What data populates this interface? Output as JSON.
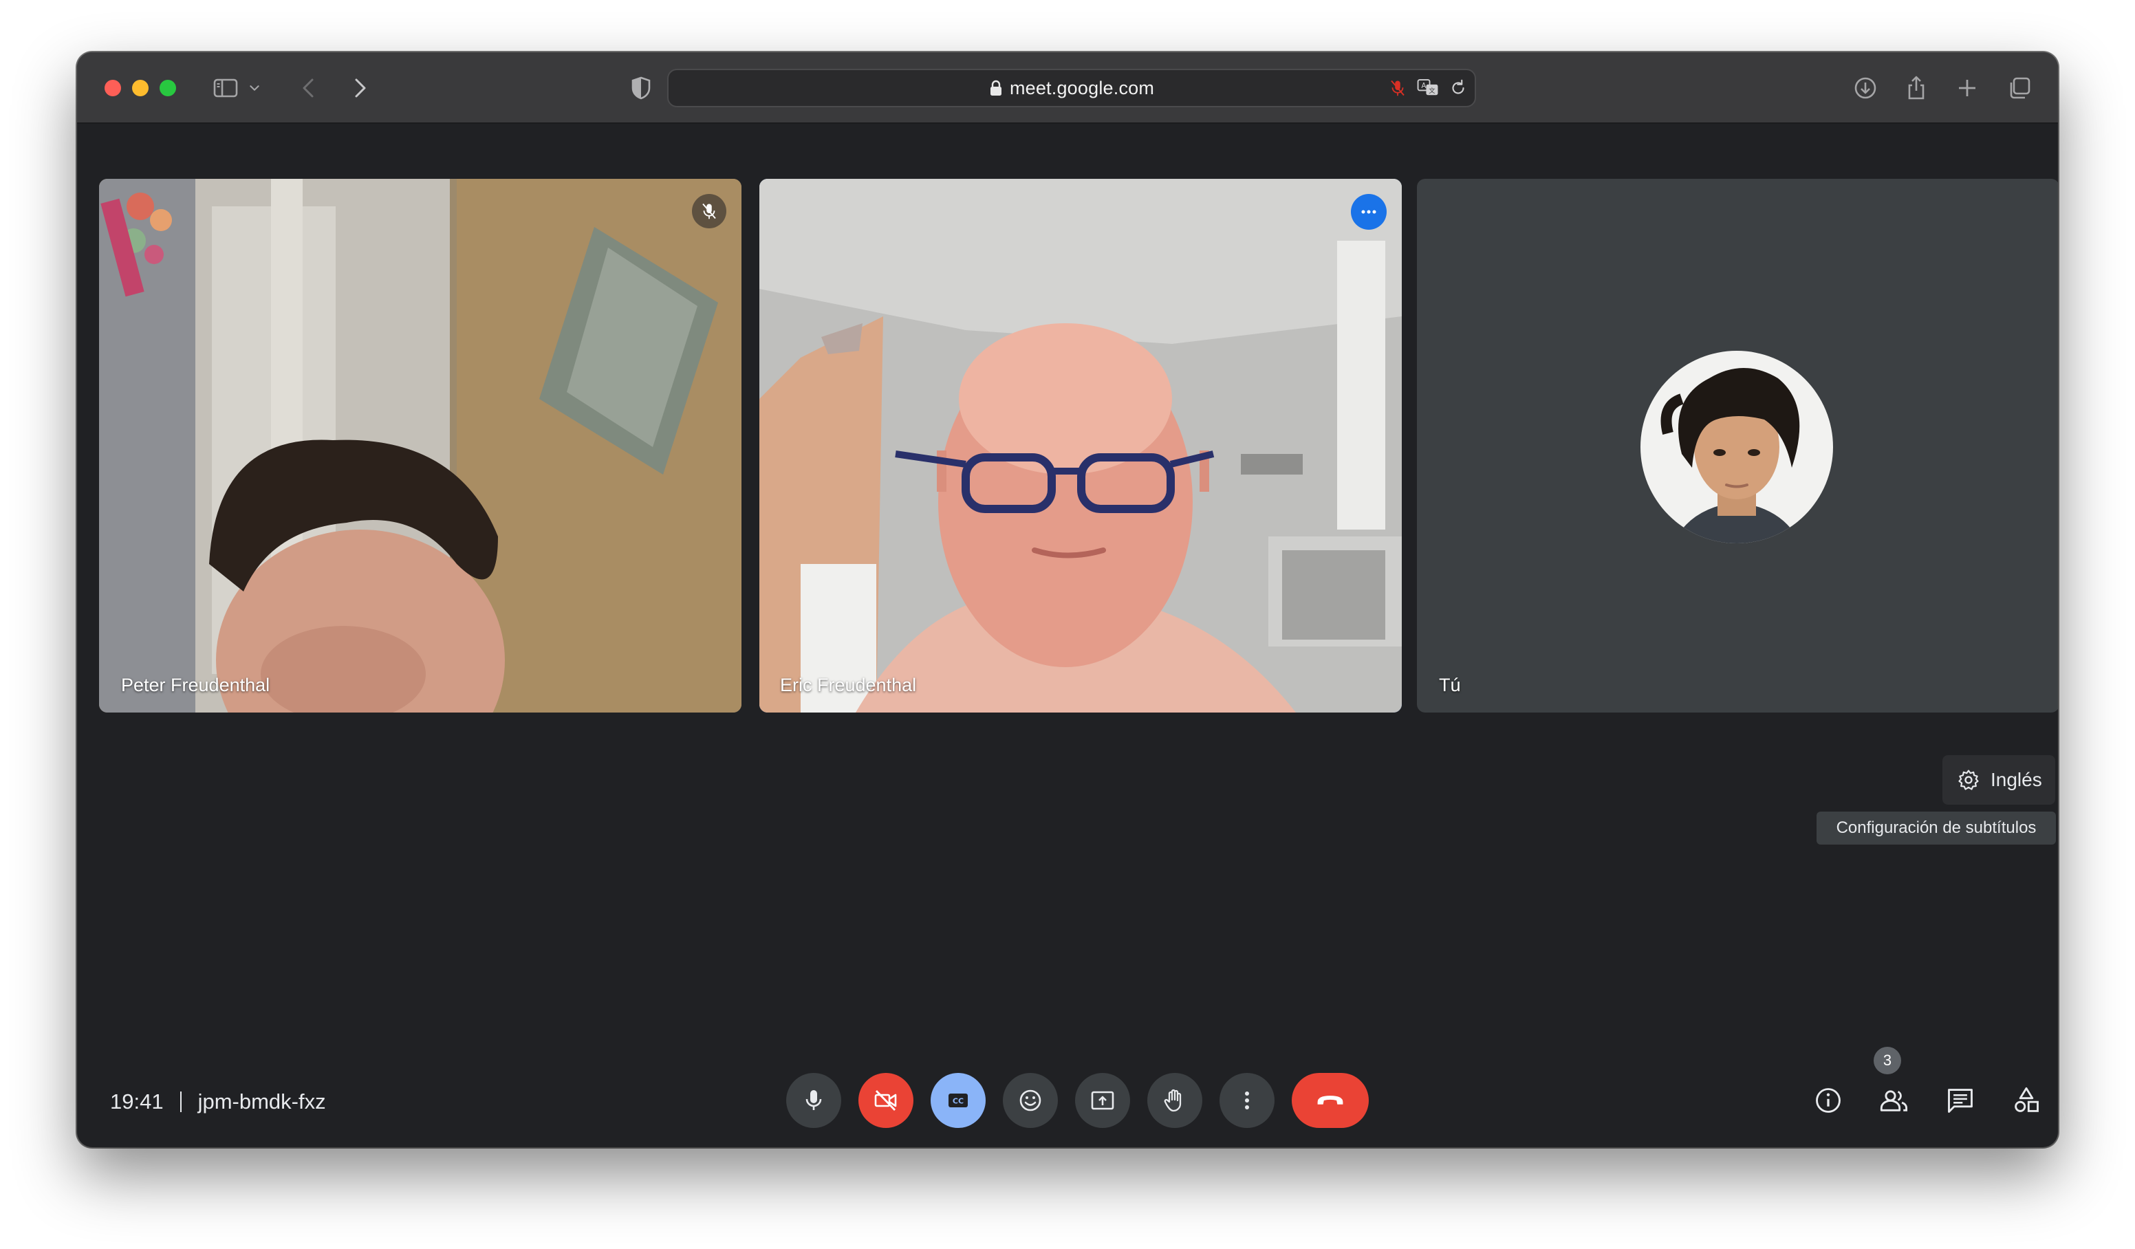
{
  "browser": {
    "url": "meet.google.com"
  },
  "participants": [
    {
      "name": "Peter Freudenthal",
      "muted": true
    },
    {
      "name": "Eric Freudenthal",
      "speaking": true
    },
    {
      "name": "Tú"
    }
  ],
  "captions": {
    "language_label": "Inglés",
    "tooltip": "Configuración de subtítulos"
  },
  "meeting": {
    "time": "19:41",
    "code": "jpm-bmdk-fxz"
  },
  "controls": {
    "people_count": "3"
  },
  "colors": {
    "background": "#202124",
    "tile": "#3c4043",
    "accent_blue": "#8ab4f8",
    "active_border": "#669df6",
    "danger_red": "#ea4335"
  },
  "icons": {
    "left": [
      "sidebar-icon",
      "chevron-down-icon",
      "back-icon",
      "forward-icon",
      "shield-icon"
    ],
    "url": [
      "lock-icon",
      "mic-muted-icon",
      "translate-icon",
      "reload-icon"
    ],
    "right": [
      "download-icon",
      "share-icon",
      "plus-icon",
      "tabs-icon"
    ],
    "meet_controls": [
      "mic-icon",
      "camera-off-icon",
      "captions-icon",
      "emoji-icon",
      "present-icon",
      "raise-hand-icon",
      "more-options-icon",
      "hangup-icon"
    ],
    "side_controls": [
      "info-icon",
      "people-icon",
      "chat-icon",
      "activities-icon"
    ]
  }
}
